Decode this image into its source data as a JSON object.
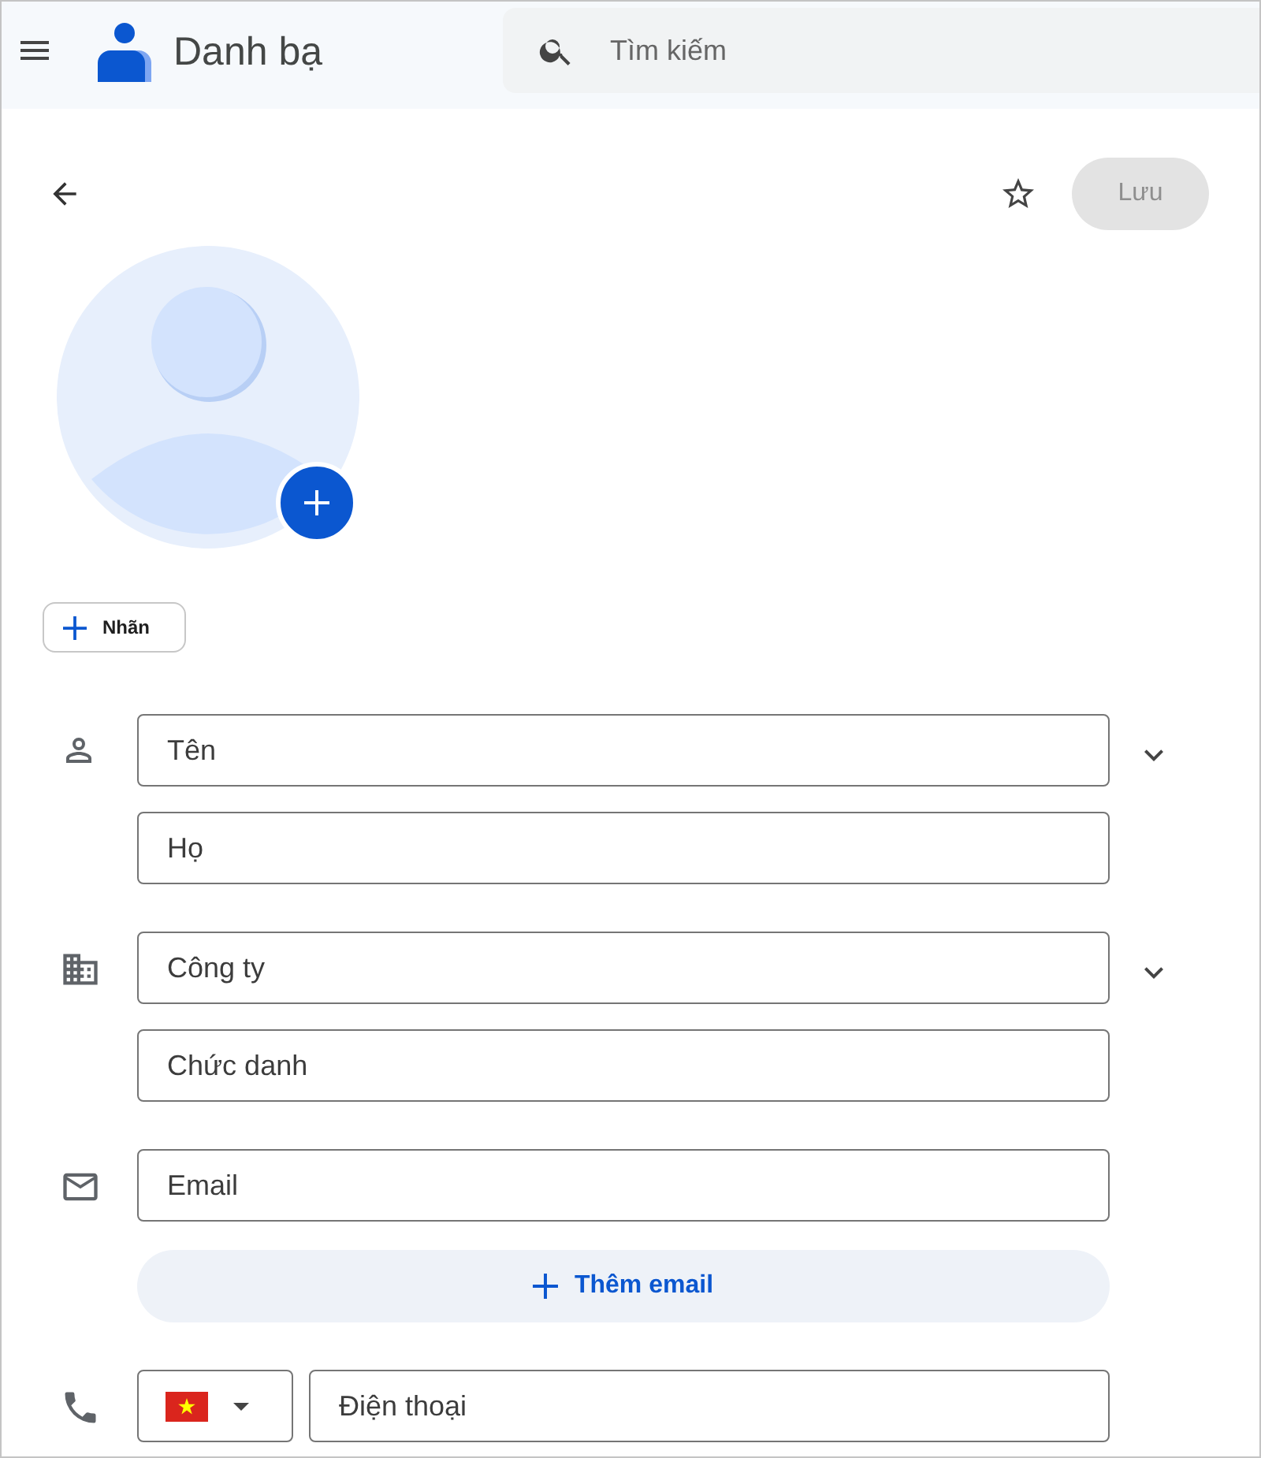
{
  "app": {
    "title": "Danh bạ"
  },
  "search": {
    "placeholder": "Tìm kiếm"
  },
  "toolbar": {
    "starred": false,
    "save": {
      "label": "Lưu",
      "disabled": true
    }
  },
  "label_button": "Nhãn",
  "sections": [
    {
      "kind": "name",
      "expandable": true,
      "fields": [
        {
          "placeholder": "Tên"
        },
        {
          "placeholder": "Họ"
        }
      ]
    },
    {
      "kind": "company",
      "expandable": true,
      "fields": [
        {
          "placeholder": "Công ty"
        },
        {
          "placeholder": "Chức danh"
        }
      ]
    },
    {
      "kind": "email",
      "expandable": false,
      "fields": [
        {
          "placeholder": "Email"
        }
      ],
      "add_button": "Thêm email"
    },
    {
      "kind": "phone",
      "expandable": false,
      "fields": [
        {
          "placeholder": "Điện thoại"
        }
      ]
    }
  ]
}
